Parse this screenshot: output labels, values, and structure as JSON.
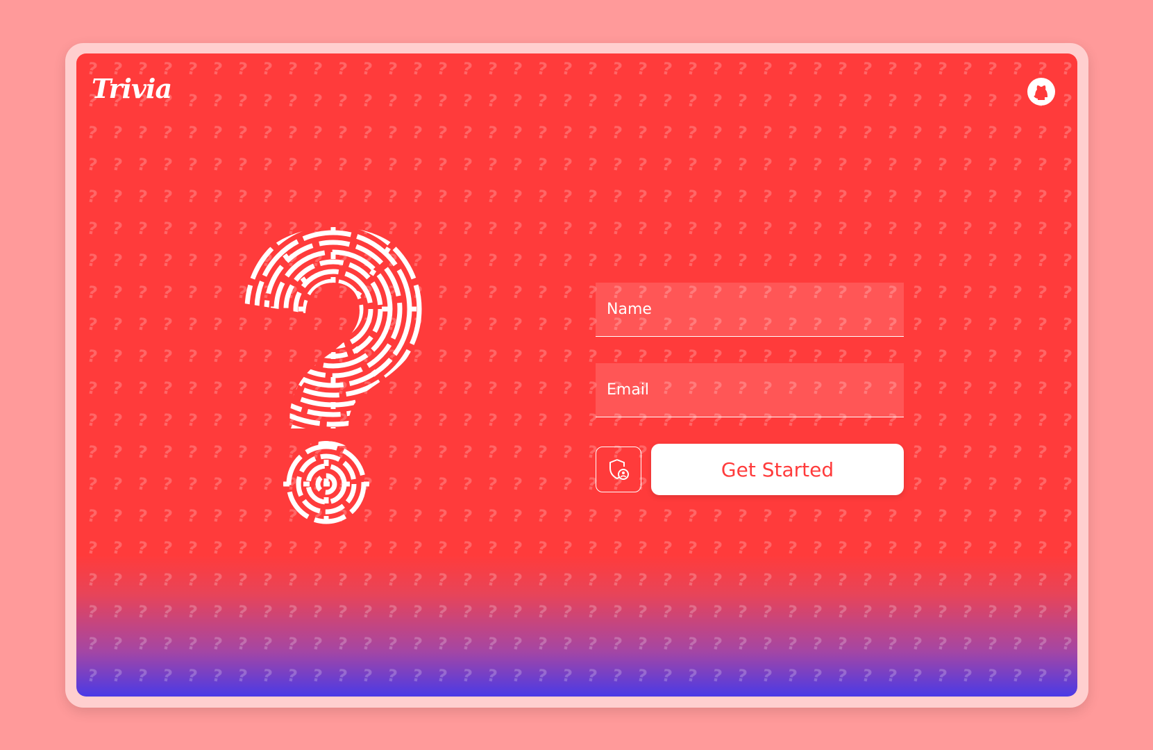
{
  "app": {
    "title": "Trivia"
  },
  "header": {
    "github_icon": "github-icon"
  },
  "form": {
    "name_placeholder": "Name",
    "email_placeholder": "Email",
    "admin_icon": "shield-user-icon",
    "start_label": "Get Started"
  },
  "colors": {
    "background": "#ff3b3b",
    "gradient_bottom": "#4a3ae6",
    "outer_background": "#ff9a9a",
    "frame": "#ffcfcf",
    "accent_text": "#ff3b3b",
    "foreground": "#ffffff"
  },
  "decor": {
    "pattern_glyph": "?",
    "hero_icon": "maze-question-mark-icon"
  }
}
